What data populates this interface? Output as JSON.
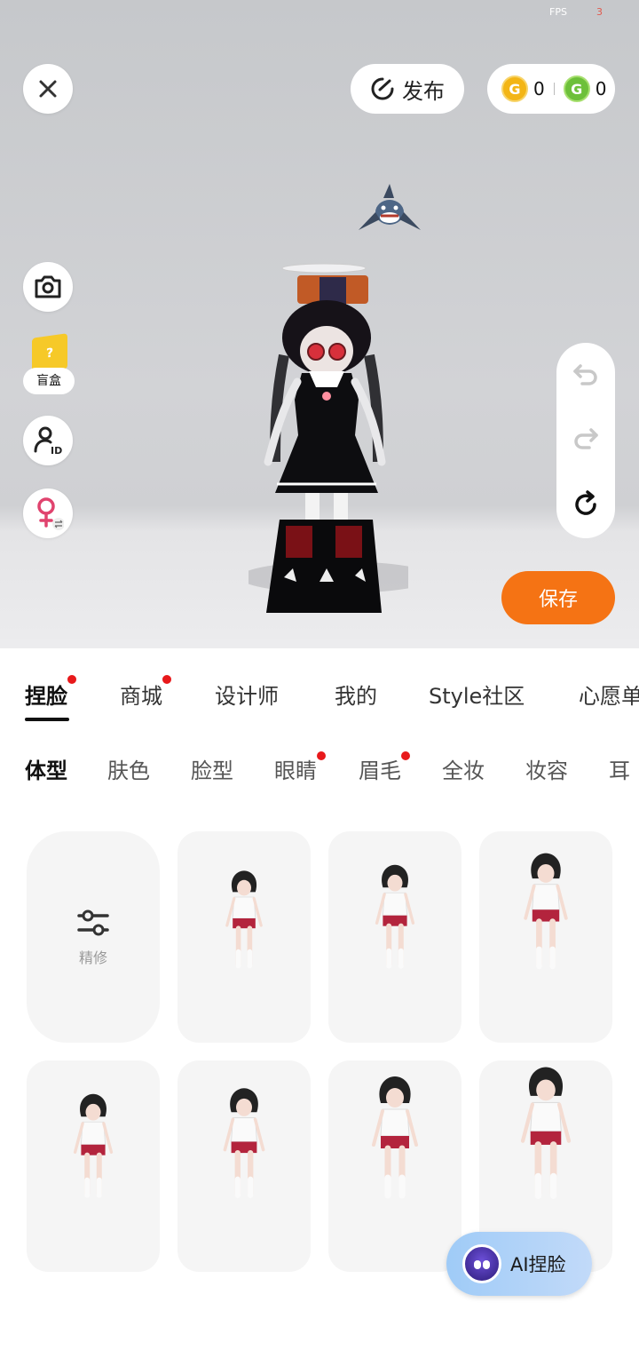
{
  "status": {
    "fps_label": "FPS",
    "fps_value": "3"
  },
  "header": {
    "publish_label": "发布",
    "coin_gold_value": "0",
    "coin_green_value": "0"
  },
  "side_tools": {
    "blind_box_label": "盲盒"
  },
  "actions": {
    "save_label": "保存"
  },
  "main_tabs": [
    {
      "label": "捏脸",
      "active": true,
      "dot": true
    },
    {
      "label": "商城",
      "active": false,
      "dot": true
    },
    {
      "label": "设计师",
      "active": false,
      "dot": false
    },
    {
      "label": "我的",
      "active": false,
      "dot": false
    },
    {
      "label": "Style社区",
      "active": false,
      "dot": false
    },
    {
      "label": "心愿单",
      "active": false,
      "dot": false
    }
  ],
  "sub_tabs": [
    {
      "label": "体型",
      "active": true,
      "dot": false
    },
    {
      "label": "肤色",
      "active": false,
      "dot": false
    },
    {
      "label": "脸型",
      "active": false,
      "dot": false
    },
    {
      "label": "眼睛",
      "active": false,
      "dot": true
    },
    {
      "label": "眉毛",
      "active": false,
      "dot": true
    },
    {
      "label": "全妆",
      "active": false,
      "dot": false
    },
    {
      "label": "妆容",
      "active": false,
      "dot": false
    },
    {
      "label": "耳朵",
      "active": false,
      "dot": false
    }
  ],
  "grid": {
    "refine_label": "精修"
  },
  "ai_button": {
    "label": "AI捏脸"
  },
  "colors": {
    "accent": "#f57314",
    "badge": "#e8191b",
    "gold_coin": "#f3b516",
    "green_coin": "#6dc03a"
  }
}
